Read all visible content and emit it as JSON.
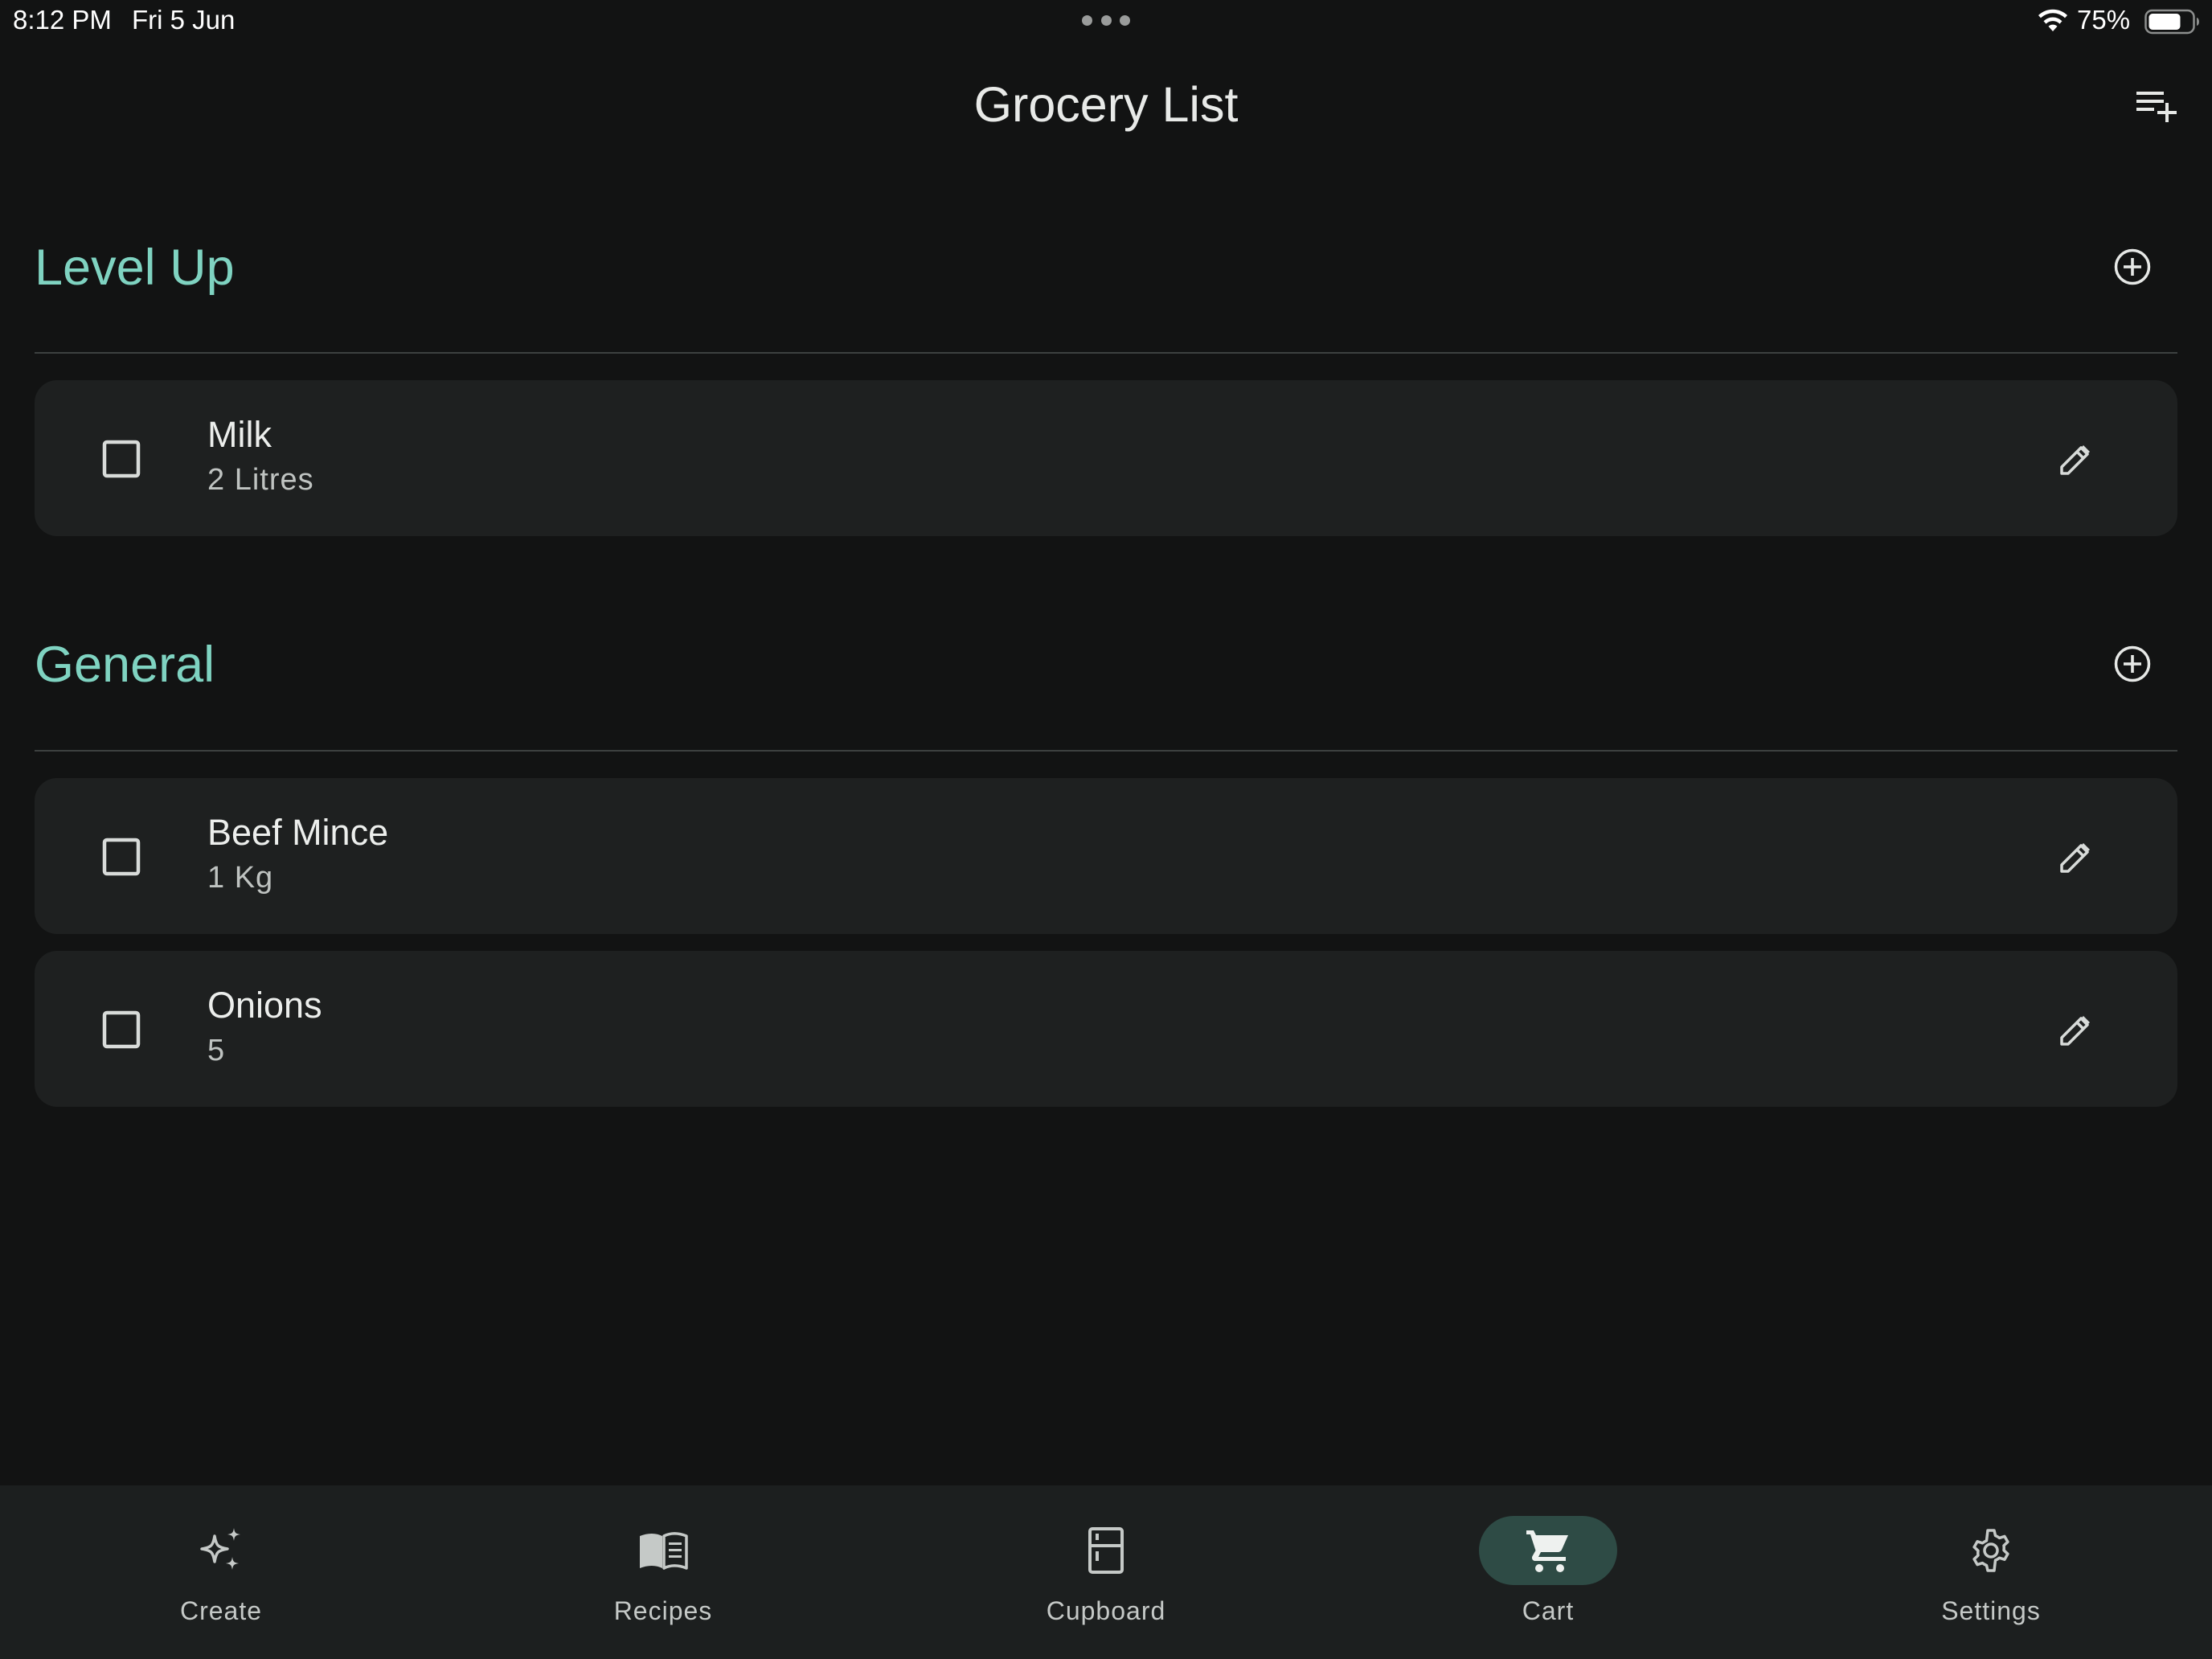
{
  "status_bar": {
    "time": "8:12 PM",
    "date": "Fri 5 Jun",
    "battery_percent": "75%",
    "battery_level": 0.75
  },
  "header": {
    "title": "Grocery List",
    "add_list_icon": "playlist-add-icon"
  },
  "sections": [
    {
      "title": "Level Up",
      "add_icon": "add-circle-icon",
      "items": [
        {
          "name": "Milk",
          "quantity": "2 Litres",
          "checked": false
        }
      ]
    },
    {
      "title": "General",
      "add_icon": "add-circle-icon",
      "items": [
        {
          "name": "Beef Mince",
          "quantity": "1 Kg",
          "checked": false
        },
        {
          "name": "Onions",
          "quantity": "5",
          "checked": false
        }
      ]
    }
  ],
  "nav": {
    "items": [
      {
        "label": "Create",
        "icon": "sparkles-icon",
        "active": false
      },
      {
        "label": "Recipes",
        "icon": "book-icon",
        "active": false
      },
      {
        "label": "Cupboard",
        "icon": "cupboard-icon",
        "active": false
      },
      {
        "label": "Cart",
        "icon": "cart-icon",
        "active": true
      },
      {
        "label": "Settings",
        "icon": "gear-icon",
        "active": false
      }
    ]
  },
  "colors": {
    "background": "#121313",
    "accent": "#7fd3c1",
    "card": "#1e2020",
    "nav_active_pill": "#2e4b45"
  }
}
